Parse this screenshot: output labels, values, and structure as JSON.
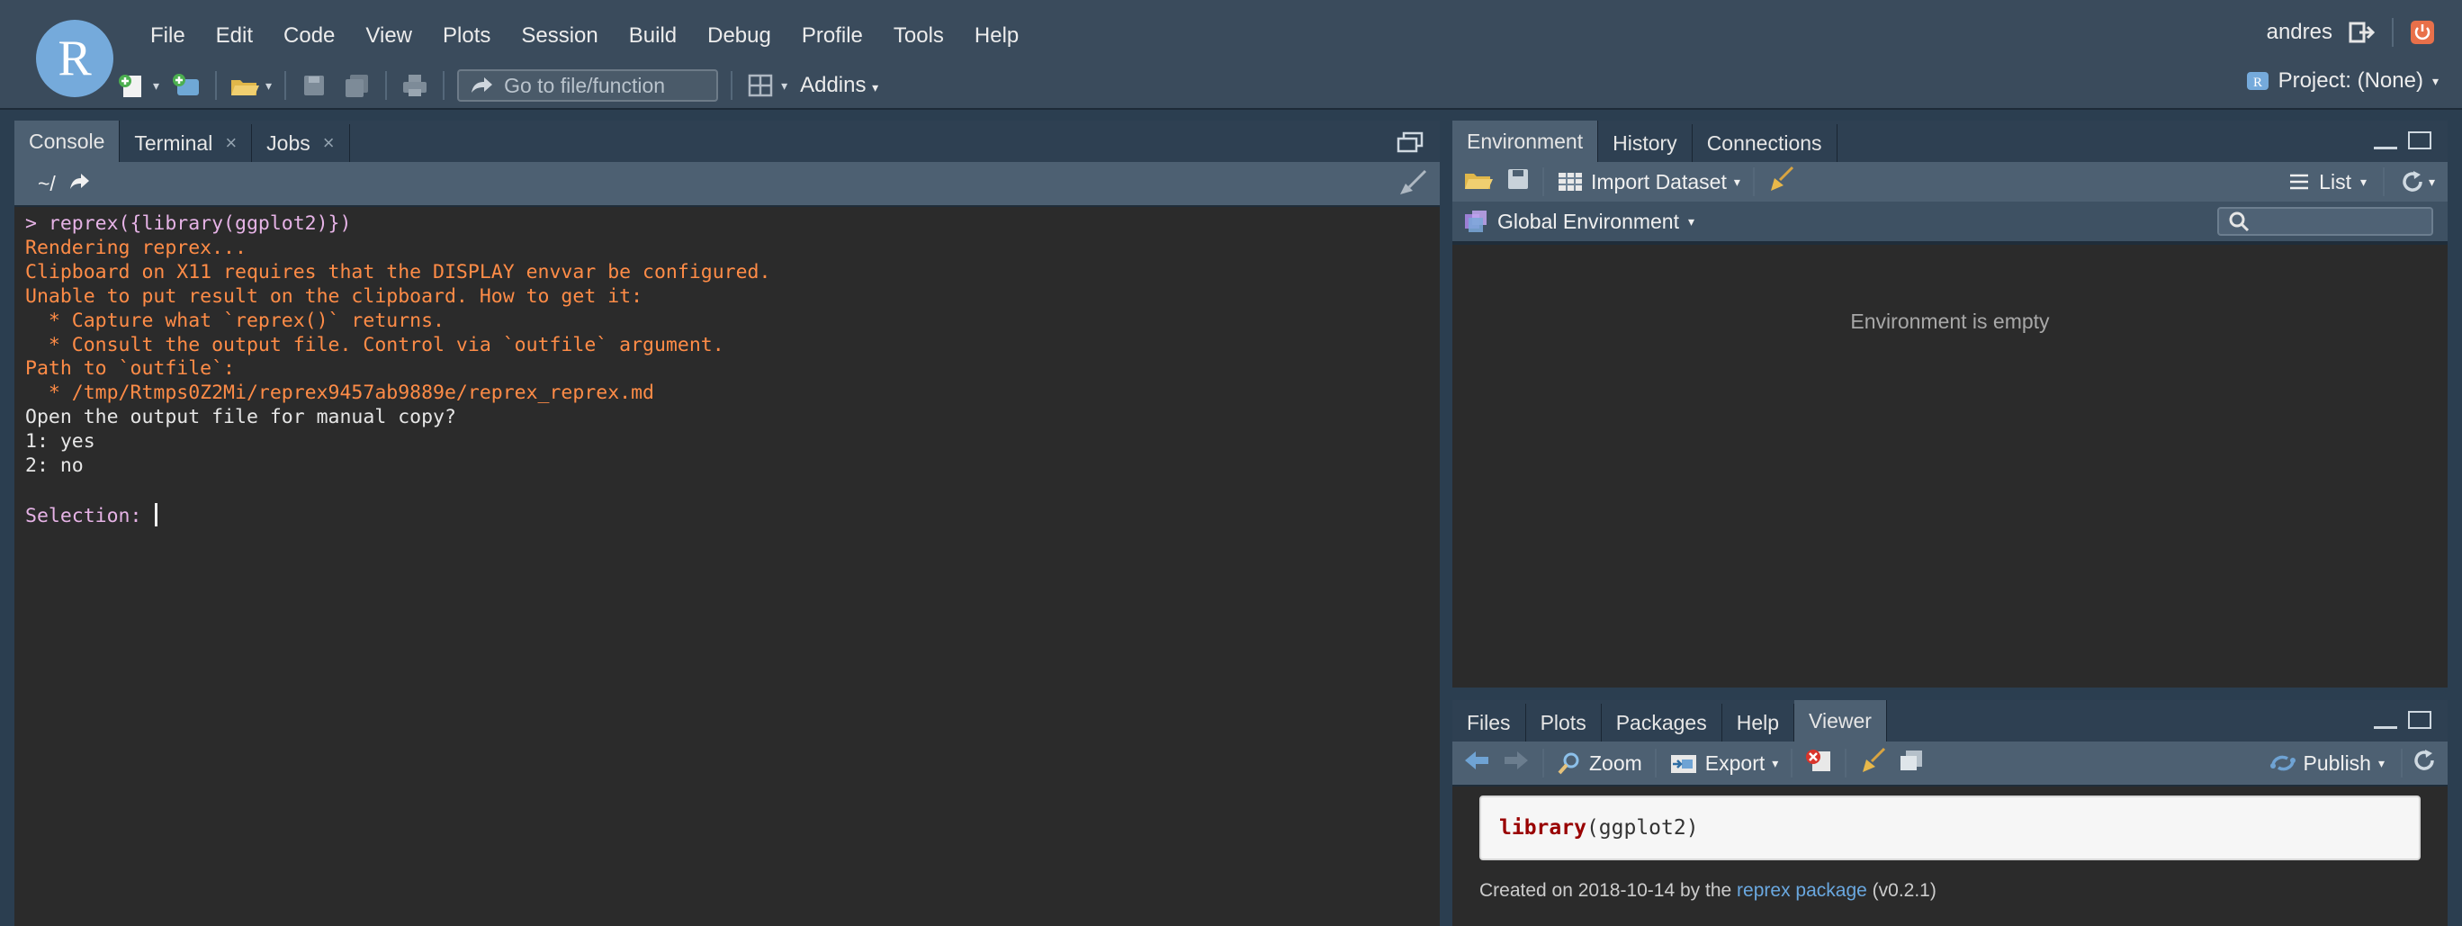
{
  "menu": [
    "File",
    "Edit",
    "Code",
    "View",
    "Plots",
    "Session",
    "Build",
    "Debug",
    "Profile",
    "Tools",
    "Help"
  ],
  "logo_letter": "R",
  "user": "andres",
  "toolbar": {
    "goto_placeholder": "Go to file/function",
    "addins_label": "Addins"
  },
  "project_label": "Project: (None)",
  "console": {
    "tabs": [
      {
        "label": "Console"
      },
      {
        "label": "Terminal"
      },
      {
        "label": "Jobs"
      }
    ],
    "path": "~/",
    "lines": {
      "l1": "> reprex({library(ggplot2)})",
      "l2": "Rendering reprex...",
      "l3": "Clipboard on X11 requires that the DISPLAY envvar be configured.",
      "l4": "Unable to put result on the clipboard. How to get it:",
      "l5": "  * Capture what `reprex()` returns.",
      "l6": "  * Consult the output file. Control via `outfile` argument.",
      "l7": "Path to `outfile`:",
      "l8": "  * /tmp/Rtmps0Z2Mi/reprex9457ab9889e/reprex_reprex.md",
      "l9": "Open the output file for manual copy?",
      "l10": "1: yes",
      "l11": "2: no",
      "l12": "",
      "l13": "Selection: "
    }
  },
  "env": {
    "tabs": [
      "Environment",
      "History",
      "Connections"
    ],
    "import_label": "Import Dataset",
    "list_label": "List",
    "scope_label": "Global Environment",
    "empty_text": "Environment is empty"
  },
  "files": {
    "tabs": [
      "Files",
      "Plots",
      "Packages",
      "Help",
      "Viewer"
    ],
    "zoom_label": "Zoom",
    "export_label": "Export",
    "publish_label": "Publish"
  },
  "viewer": {
    "code_kw": "library",
    "code_rest": "(ggplot2)",
    "created_prefix": "Created on 2018-10-14 by the ",
    "link_text": "reprex package",
    "created_suffix": " (v0.2.1)"
  },
  "colors": {
    "accent": "#75aadb",
    "warning_text": "#ff8c47",
    "prompt_text": "#e6b3e6"
  }
}
